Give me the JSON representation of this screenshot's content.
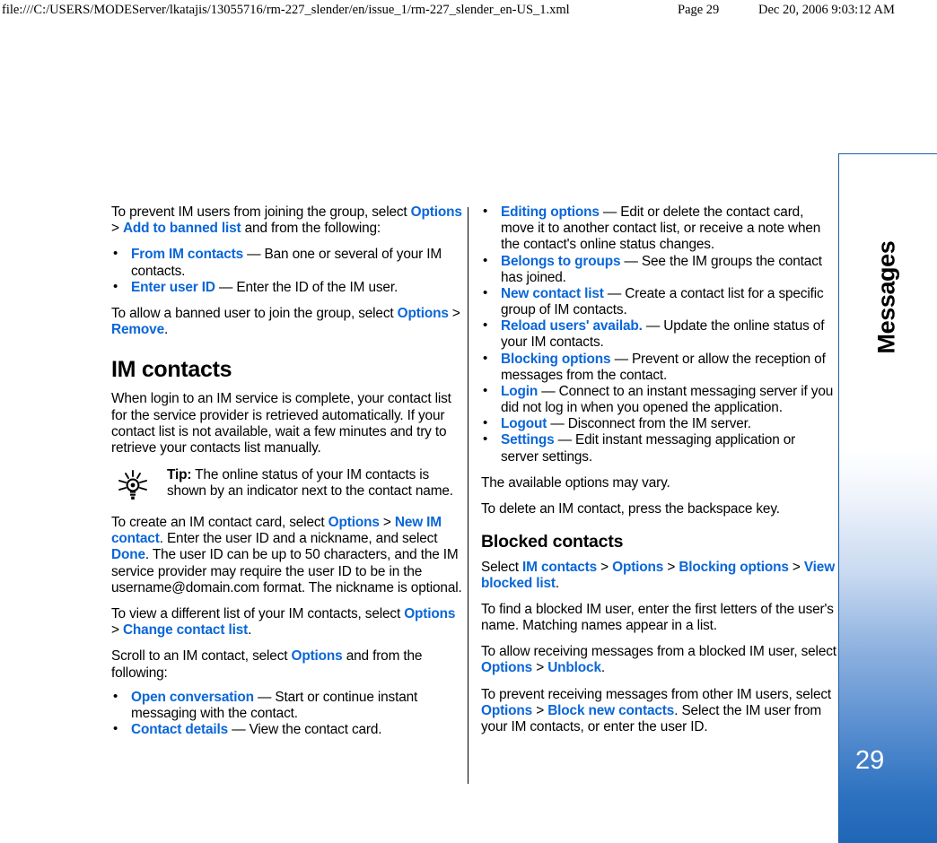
{
  "print_header": {
    "url": "file:///C:/USERS/MODEServer/lkatajis/13055716/rm-227_slender/en/issue_1/rm-227_slender_en-US_1.xml",
    "page": "Page 29",
    "date": "Dec 20, 2006 9:03:12 AM"
  },
  "chapter_tab": {
    "label": "Messages",
    "page_number": "29",
    "gradient_top_color": "#ffffff",
    "gradient_bottom_color": "#1f66b6",
    "border_color": "#1a5fa8"
  },
  "link_color": "#0a66d8",
  "left_column": {
    "p1": {
      "a": "To prevent IM users from joining the group, select ",
      "link1": "Options",
      "sep1": " > ",
      "link2": "Add to banned list",
      "b": " and from the following:"
    },
    "bullets1": [
      {
        "term": "From IM contacts",
        "dash": " — ",
        "desc": "Ban one or several of your IM contacts."
      },
      {
        "term": "Enter user ID",
        "dash": " — ",
        "desc": "Enter the ID of the IM user."
      }
    ],
    "p2": {
      "a": "To allow a banned user to join the group, select ",
      "link1": "Options",
      "sep1": " > ",
      "link2": "Remove",
      "b": "."
    },
    "heading_im_contacts": "IM contacts",
    "p3": "When login to an IM service is complete, your contact list for the service provider is retrieved automatically. If your contact list is not available, wait a few minutes and try to retrieve your contacts list manually.",
    "tip": {
      "icon": "lightbulb-tip-icon",
      "label": "Tip:",
      "text": " The online status of your IM contacts is shown by an indicator next to the contact name."
    },
    "p4": {
      "a": "To create an IM contact card, select ",
      "link1": "Options",
      "sep1": " > ",
      "link2": "New IM contact",
      "b": ". Enter the user ID and a nickname, and select ",
      "link3": "Done",
      "c": ". The user ID can be up to 50 characters, and the IM service provider may require the user ID to be in the username@domain.com format. The nickname is optional."
    },
    "p5": {
      "a": "To view a different list of your IM contacts, select ",
      "link1": "Options",
      "sep1": " > ",
      "link2": "Change contact list",
      "b": "."
    },
    "p6": {
      "a": "Scroll to an IM contact, select ",
      "link1": "Options",
      "b": " and from the following:"
    },
    "bullets2": [
      {
        "term": "Open conversation",
        "dash": " — ",
        "desc": "Start or continue instant messaging with the contact."
      },
      {
        "term": "Contact details",
        "dash": " — ",
        "desc": "View the contact card."
      }
    ]
  },
  "right_column": {
    "bullets1": [
      {
        "term": "Editing options",
        "dash": " — ",
        "desc": "Edit or delete the contact card, move it to another contact list, or receive a note when the contact's online status changes."
      },
      {
        "term": "Belongs to groups",
        "dash": " — ",
        "desc": "See the IM groups the contact has joined."
      },
      {
        "term": "New contact list",
        "dash": " — ",
        "desc": "Create a contact list for a specific group of IM contacts."
      },
      {
        "term": "Reload users' availab.",
        "dash": " — ",
        "desc": "Update the online status of your IM contacts."
      },
      {
        "term": "Blocking options",
        "dash": " — ",
        "desc": "Prevent or allow the reception of messages from the contact."
      },
      {
        "term": "Login",
        "dash": " — ",
        "desc": "Connect to an instant messaging server if you did not log in when you opened the application."
      },
      {
        "term": "Logout",
        "dash": " — ",
        "desc": "Disconnect from the IM server."
      },
      {
        "term": "Settings",
        "dash": " — ",
        "desc": "Edit instant messaging application or server settings."
      }
    ],
    "p1": "The available options may vary.",
    "p2": "To delete an IM contact, press the backspace key.",
    "heading_blocked_contacts": "Blocked contacts",
    "p3": {
      "a": "Select ",
      "link1": "IM contacts",
      "sep1": " > ",
      "link2": "Options",
      "sep2": " > ",
      "link3": "Blocking options",
      "sep3": " > ",
      "link4": "View blocked list",
      "b": "."
    },
    "p4": "To find a blocked IM user, enter the first letters of the user's name. Matching names appear in a list.",
    "p5": {
      "a": "To allow receiving messages from a blocked IM user, select ",
      "link1": "Options",
      "sep1": " > ",
      "link2": "Unblock",
      "b": "."
    },
    "p6": {
      "a": "To prevent receiving messages from other IM users, select ",
      "link1": "Options",
      "sep1": " > ",
      "link2": "Block new contacts",
      "b": ". Select the IM user from your IM contacts, or enter the user ID."
    }
  }
}
